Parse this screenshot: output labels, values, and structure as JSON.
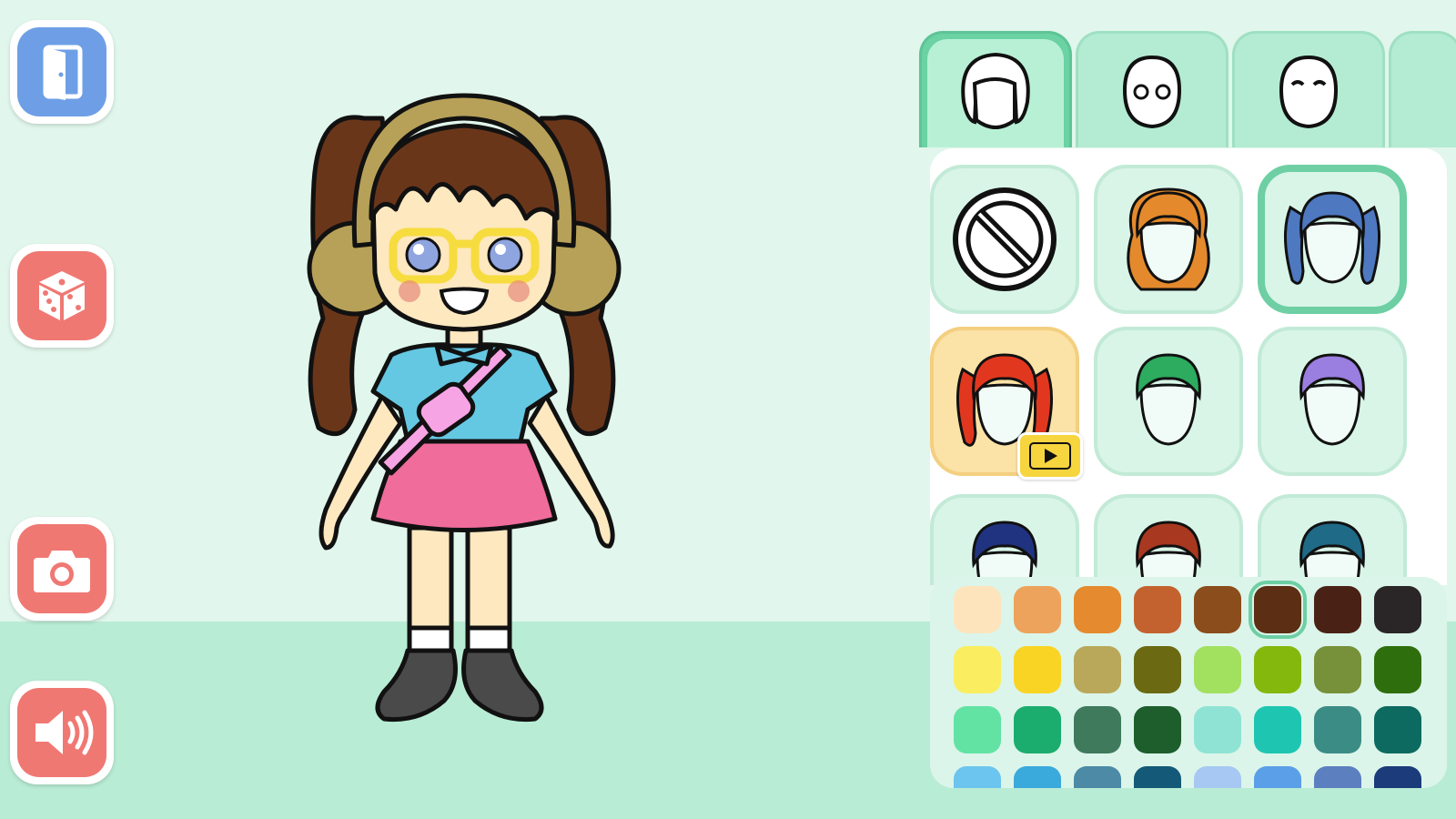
{
  "sidebar": {
    "buttons": [
      {
        "name": "exit",
        "icon": "door-exit-icon",
        "color": "#6e9fe6"
      },
      {
        "name": "random",
        "icon": "dice-icon",
        "color": "#f07873"
      },
      {
        "name": "camera",
        "icon": "camera-icon",
        "color": "#f07873"
      },
      {
        "name": "sound",
        "icon": "speaker-icon",
        "color": "#f07873"
      }
    ]
  },
  "category_tabs": [
    {
      "name": "hair",
      "icon": "hair-category-icon",
      "active": true
    },
    {
      "name": "eyes",
      "icon": "eyes-category-icon",
      "active": false
    },
    {
      "name": "eyebrows",
      "icon": "eyebrows-category-icon",
      "active": false
    }
  ],
  "hair_options": [
    {
      "name": "none",
      "icon": "none-icon",
      "color": null,
      "selected": false,
      "locked": false
    },
    {
      "name": "orange-wavy",
      "icon": "hair-style-icon",
      "color": "#e48a2c",
      "selected": false,
      "locked": false
    },
    {
      "name": "blue-pigtails",
      "icon": "hair-style-icon",
      "color": "#4e78c0",
      "selected": true,
      "locked": false
    },
    {
      "name": "red-braids",
      "icon": "hair-style-icon",
      "color": "#e2371f",
      "selected": false,
      "locked": true
    },
    {
      "name": "green-short",
      "icon": "hair-style-icon",
      "color": "#2dab5f",
      "selected": false,
      "locked": false
    },
    {
      "name": "purple-swoop",
      "icon": "hair-style-icon",
      "color": "#9a7ee0",
      "selected": false,
      "locked": false
    },
    {
      "name": "navy-curly",
      "icon": "hair-style-icon",
      "color": "#1f3380",
      "selected": false,
      "locked": false
    },
    {
      "name": "brown-spiky",
      "icon": "hair-style-icon",
      "color": "#a8381f",
      "selected": false,
      "locked": false
    },
    {
      "name": "teal-short",
      "icon": "hair-style-icon",
      "color": "#1e6a87",
      "selected": false,
      "locked": false
    }
  ],
  "palette": {
    "selected_index": 5,
    "colors": [
      "#fde4bd",
      "#eda35b",
      "#e58a2e",
      "#c4622f",
      "#8b4d1c",
      "#5c2e13",
      "#4a2215",
      "#2a2526",
      "#faed5f",
      "#f9d424",
      "#b9a85a",
      "#6b6a12",
      "#a2e060",
      "#84b80d",
      "#77913a",
      "#2f6e0c",
      "#62e3a4",
      "#1bad6e",
      "#3f7a5c",
      "#1d5e2c",
      "#8fe3d4",
      "#1ec6b2",
      "#3c8c86",
      "#0d6a60",
      "#6cc5ee",
      "#3aa9dc",
      "#4c8aa6",
      "#145a78",
      "#a6c8f2",
      "#5b9fe8",
      "#5c7fc0",
      "#1c3b7a"
    ]
  },
  "character": {
    "hair_color": "#5c2e13",
    "headband_color": "#b7a158",
    "glasses_color": "#f6dc3f",
    "shirt_color": "#65c8e3",
    "skirt_color": "#f06c9b",
    "bag_color": "#f7a4e4",
    "skin_color": "#fde8c0",
    "shoes_color": "#4a4a4a"
  }
}
